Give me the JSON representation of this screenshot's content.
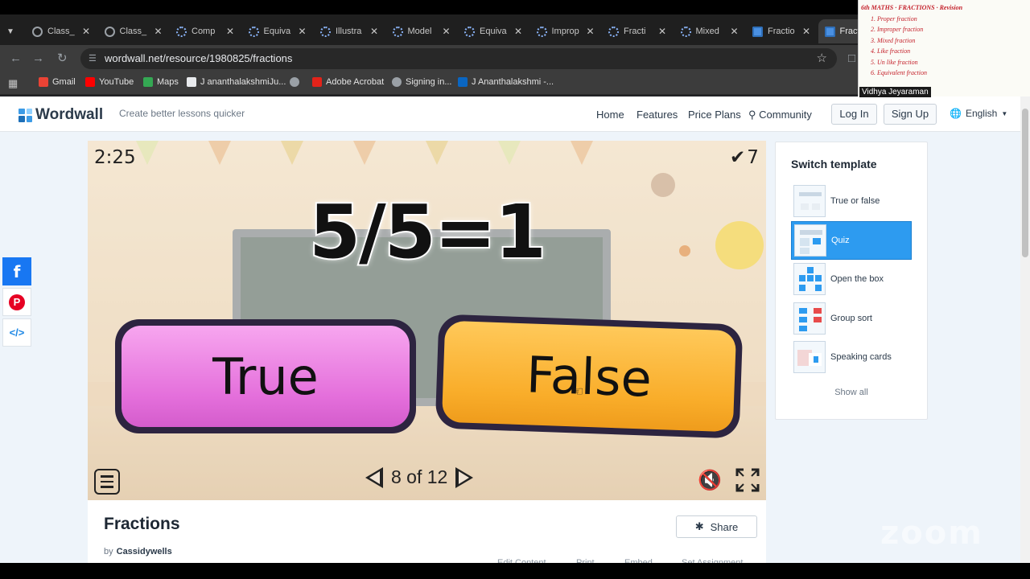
{
  "browser": {
    "tabs": [
      {
        "label": "Class_",
        "icon": "globe"
      },
      {
        "label": "Class_",
        "icon": "globe"
      },
      {
        "label": "Comp",
        "icon": "loading"
      },
      {
        "label": "Equiva",
        "icon": "loading"
      },
      {
        "label": "Illustra",
        "icon": "loading"
      },
      {
        "label": "Model",
        "icon": "loading"
      },
      {
        "label": "Equiva",
        "icon": "loading"
      },
      {
        "label": "Improp",
        "icon": "loading"
      },
      {
        "label": "Fracti",
        "icon": "loading"
      },
      {
        "label": "Mixed",
        "icon": "loading"
      },
      {
        "label": "Fractio",
        "icon": "wordwall"
      },
      {
        "label": "Fractio",
        "icon": "wordwall",
        "active": true
      }
    ],
    "address": "wordwall.net/resource/1980825/fractions",
    "bookmarks": [
      {
        "label": "Gmail",
        "color": "#ea4335"
      },
      {
        "label": "YouTube",
        "color": "#ff0000"
      },
      {
        "label": "Maps",
        "color": "#34a853"
      },
      {
        "label": "J ananthalakshmiJu...",
        "color": "#e8eaed"
      },
      {
        "label": "",
        "color": "#9aa0a6"
      },
      {
        "label": "Adobe Acrobat",
        "color": "#e2231a"
      },
      {
        "label": "Signing in...",
        "color": "#9aa0a6"
      },
      {
        "label": "J Ananthalakshmi -...",
        "color": "#0a66c2"
      }
    ]
  },
  "site": {
    "brand": "Wordwall",
    "tagline": "Create better lessons quicker",
    "nav": [
      "Home",
      "Features",
      "Price Plans",
      "Community"
    ],
    "login": "Log In",
    "signup": "Sign Up",
    "language": "English"
  },
  "game": {
    "timer": "2:25",
    "score": "7",
    "question": "5/5=1",
    "answers": [
      "True",
      "False"
    ],
    "pager": "8 of 12",
    "progress": {
      "current": 8,
      "total": 12
    }
  },
  "resource": {
    "title": "Fractions",
    "by_label": "by",
    "author": "Cassidywells",
    "share": "Share",
    "actions": [
      "Edit Content",
      "Print",
      "Embed",
      "Set Assignment"
    ]
  },
  "switch_template": {
    "title": "Switch template",
    "items": [
      {
        "label": "True or false",
        "selected": false
      },
      {
        "label": "Quiz",
        "selected": true
      },
      {
        "label": "Open the box",
        "selected": false
      },
      {
        "label": "Group sort",
        "selected": false
      },
      {
        "label": "Speaking cards",
        "selected": false
      }
    ],
    "show_all": "Show all"
  },
  "zoom": {
    "participant": "Vidhya Jeyaraman",
    "watermark": "zoom",
    "notes": [
      "6th MATHS · FRACTIONS · Revision",
      "1. Proper fraction",
      "2. Improper fraction",
      "3. Mixed fraction",
      "4. Like fraction",
      "5. Un like fraction",
      "6. Equivalent fraction"
    ]
  },
  "colors": {
    "accent": "#2d9bf0",
    "true_button": "#e46fdb",
    "false_button": "#f9ad2a",
    "facebook": "#1877f2",
    "pinterest": "#e60023"
  }
}
